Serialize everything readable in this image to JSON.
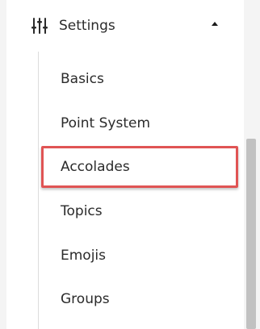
{
  "settings": {
    "icon": "sliders-icon",
    "label": "Settings",
    "expanded": true,
    "items": [
      {
        "label": "Basics"
      },
      {
        "label": "Point System"
      },
      {
        "label": "Accolades",
        "highlighted": true
      },
      {
        "label": "Topics"
      },
      {
        "label": "Emojis"
      },
      {
        "label": "Groups"
      }
    ]
  },
  "colors": {
    "highlight_border": "#e05454",
    "text": "#2b2b2b",
    "scrollbar_thumb": "#c1c1c1"
  }
}
